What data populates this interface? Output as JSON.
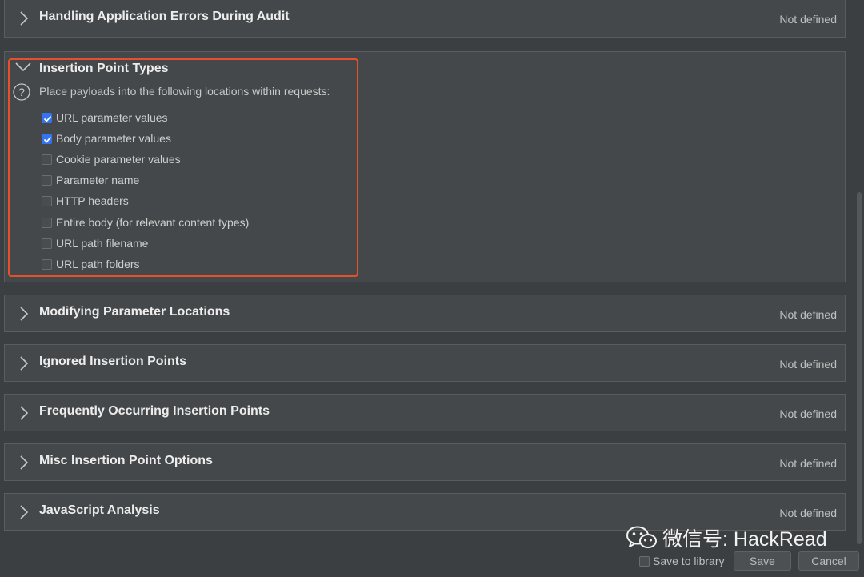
{
  "panels_top": {
    "title": "Handling Application Errors During Audit",
    "status": "Not defined"
  },
  "insertion": {
    "title": "Insertion Point Types",
    "description": "Place payloads into the following locations within requests:",
    "options": [
      {
        "label": "URL parameter values",
        "checked": true
      },
      {
        "label": "Body parameter values",
        "checked": true
      },
      {
        "label": "Cookie parameter values",
        "checked": false
      },
      {
        "label": "Parameter name",
        "checked": false
      },
      {
        "label": "HTTP headers",
        "checked": false
      },
      {
        "label": "Entire body (for relevant content types)",
        "checked": false
      },
      {
        "label": "URL path filename",
        "checked": false
      },
      {
        "label": "URL path folders",
        "checked": false
      }
    ]
  },
  "panels": [
    {
      "title": "Modifying Parameter Locations",
      "status": "Not defined"
    },
    {
      "title": "Ignored Insertion Points",
      "status": "Not defined"
    },
    {
      "title": "Frequently Occurring Insertion Points",
      "status": "Not defined"
    },
    {
      "title": "Misc Insertion Point Options",
      "status": "Not defined"
    },
    {
      "title": "JavaScript Analysis",
      "status": "Not defined"
    }
  ],
  "footer": {
    "save_to_library": "Save to library",
    "save": "Save",
    "cancel": "Cancel"
  },
  "watermark": {
    "text": "微信号: HackRead",
    "icon": "wechat-icon"
  },
  "colors": {
    "background": "#3c3f41",
    "panel": "#45484a",
    "checkbox_checked": "#3574f0",
    "highlight": "#e8502a"
  }
}
